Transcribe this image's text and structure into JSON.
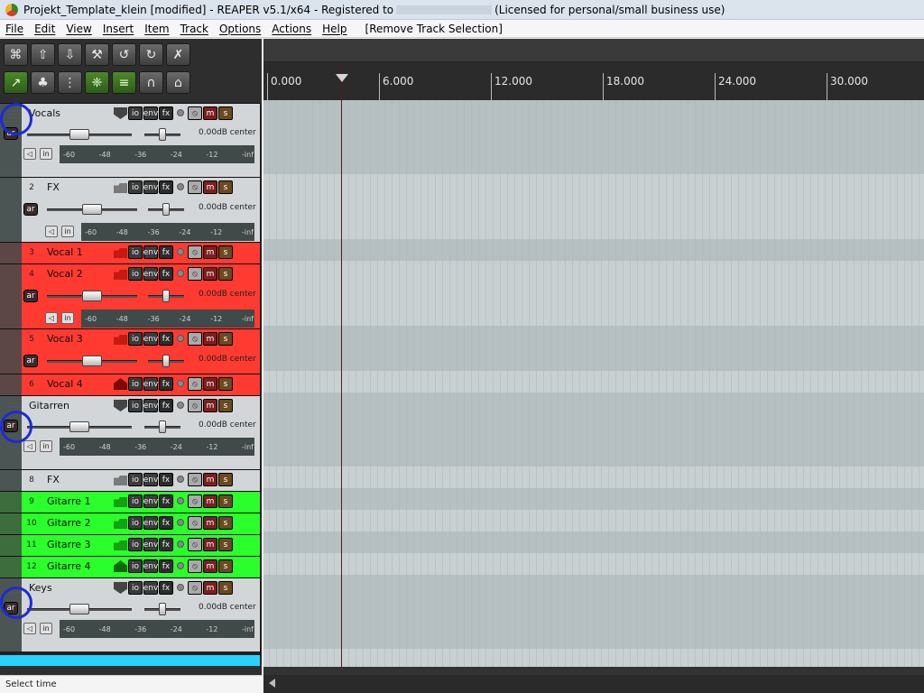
{
  "window": {
    "title_prefix": "Projekt_Template_klein [modified] - REAPER v5.1/x64 - Registered to",
    "title_suffix": "(Licensed for personal/small business use)"
  },
  "menu": {
    "items": [
      "File",
      "Edit",
      "View",
      "Insert",
      "Item",
      "Track",
      "Options",
      "Actions",
      "Help"
    ],
    "extra": "Remove Track Selection"
  },
  "toolbar": {
    "row1_icons": [
      "new-project-icon",
      "open-project-icon",
      "save-project-icon",
      "project-settings-icon",
      "undo-icon",
      "redo-icon",
      "metronome-icon"
    ],
    "row2_icons": [
      "auto-crossfade-icon",
      "ripple-edit-icon",
      "grid-icon",
      "envelope-lock-icon",
      "snap-icon",
      "item-grouping-icon",
      "lock-icon"
    ],
    "glyphs": {
      "row1": [
        "⌘",
        "⇧",
        "⇩",
        "⚒",
        "↺",
        "↻",
        "✗"
      ],
      "row2": [
        "↗",
        "♣",
        "⋮",
        "❈",
        "≡",
        "∩",
        "⌂"
      ]
    }
  },
  "tracks": [
    {
      "name": "Vocals",
      "num": "",
      "color": "grey",
      "type": "folder",
      "vol": "0.00dB",
      "pan": "center",
      "fader_level": 0.5
    },
    {
      "name": "FX",
      "num": "2",
      "color": "grey",
      "type": "full",
      "vol": "0.00dB",
      "pan": "center",
      "fader_level": 0.5
    },
    {
      "name": "Vocal 1",
      "num": "3",
      "color": "red",
      "type": "compact"
    },
    {
      "name": "Vocal 2",
      "num": "4",
      "color": "red",
      "type": "full",
      "vol": "0.00dB",
      "pan": "center",
      "fader_level": 0.5
    },
    {
      "name": "Vocal 3",
      "num": "5",
      "color": "red",
      "type": "half",
      "vol": "0.00dB",
      "pan": "center",
      "fader_level": 0.5
    },
    {
      "name": "Vocal 4",
      "num": "6",
      "color": "red",
      "type": "compact-house"
    },
    {
      "name": "Gitarren",
      "num": "",
      "color": "grey",
      "type": "folder",
      "vol": "0.00dB",
      "pan": "center",
      "fader_level": 0.5
    },
    {
      "name": "FX",
      "num": "8",
      "color": "grey",
      "type": "compact"
    },
    {
      "name": "Gitarre 1",
      "num": "9",
      "color": "green",
      "type": "compact"
    },
    {
      "name": "Gitarre 2",
      "num": "10",
      "color": "green",
      "type": "compact"
    },
    {
      "name": "Gitarre 3",
      "num": "11",
      "color": "green",
      "type": "compact"
    },
    {
      "name": "Gitarre 4",
      "num": "12",
      "color": "green",
      "type": "compact-house"
    },
    {
      "name": "Keys",
      "num": "",
      "color": "grey",
      "type": "folder",
      "vol": "0.00dB",
      "pan": "center",
      "fader_level": 0.5
    }
  ],
  "track_buttons": {
    "io": "io",
    "env": "env",
    "fx": "fx",
    "mute": "m",
    "solo": "s",
    "arm": "ar",
    "mono": "◁",
    "in": "in"
  },
  "meter_scale": [
    "-60",
    "-48",
    "-36",
    "-24",
    "-12",
    "-inf"
  ],
  "ruler": {
    "labels": [
      "0.000",
      "6.000",
      "12.000",
      "18.000",
      "24.000",
      "30.000"
    ]
  },
  "status": "Select time",
  "colors": {
    "red_track": "#ff3a31",
    "green_track": "#2bff2b",
    "grey_track": "#d3d6d8",
    "highlight_ring": "#1c2bd6"
  }
}
